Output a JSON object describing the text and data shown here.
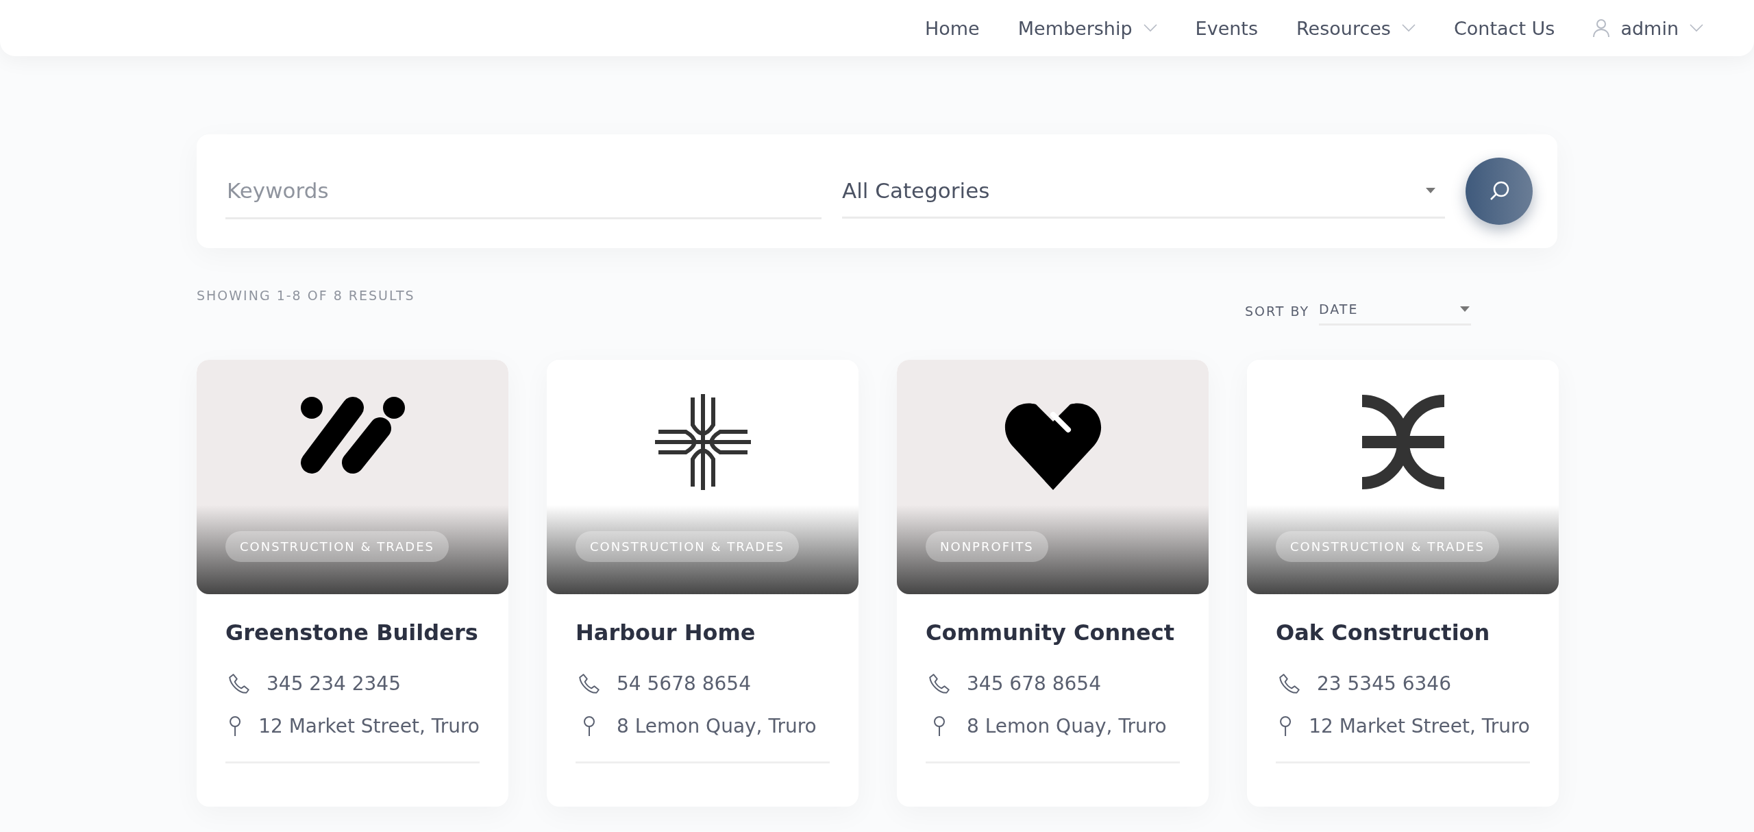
{
  "nav": {
    "items": [
      {
        "label": "Home",
        "dropdown": false
      },
      {
        "label": "Membership",
        "dropdown": true
      },
      {
        "label": "Events",
        "dropdown": false
      },
      {
        "label": "Resources",
        "dropdown": true
      },
      {
        "label": "Contact Us",
        "dropdown": false
      }
    ],
    "user": {
      "label": "admin"
    }
  },
  "search": {
    "keywords": {
      "placeholder": "Keywords"
    },
    "category": {
      "value": "All Categories"
    }
  },
  "results": {
    "summary": "SHOWING 1-8 OF 8 RESULTS",
    "sort_label": "SORT BY",
    "sort_value": "DATE"
  },
  "cards": [
    {
      "name": "Greenstone Builders",
      "category": "CONSTRUCTION & TRADES",
      "phone": "345 234 2345",
      "address": "12 Market Street, Truro",
      "kind": "slashes"
    },
    {
      "name": "Harbour Home",
      "category": "CONSTRUCTION & TRADES",
      "phone": "54 5678 8654",
      "address": "8 Lemon Quay, Truro",
      "kind": "cross"
    },
    {
      "name": "Community Connect",
      "category": "NONPROFITS",
      "phone": "345 678 8654",
      "address": "8 Lemon Quay, Truro",
      "kind": "heart"
    },
    {
      "name": "Oak Construction",
      "category": "CONSTRUCTION & TRADES",
      "phone": "23 5345 6346",
      "address": "12 Market Street, Truro",
      "kind": "arcs"
    }
  ]
}
